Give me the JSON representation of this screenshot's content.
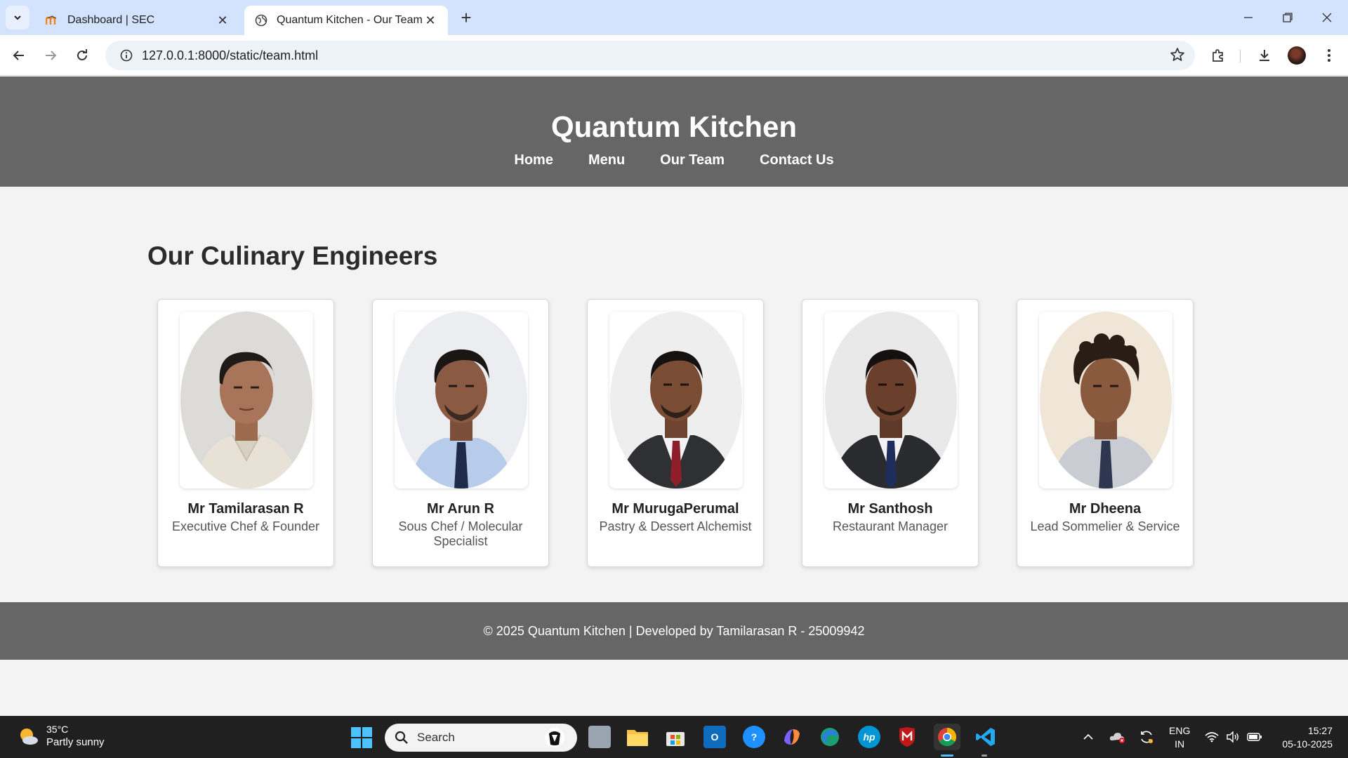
{
  "browser": {
    "tabs": [
      {
        "title": "Dashboard | SEC",
        "active": false
      },
      {
        "title": "Quantum Kitchen - Our Team",
        "active": true
      }
    ],
    "url": "127.0.0.1:8000/static/team.html"
  },
  "site": {
    "title": "Quantum Kitchen",
    "nav": [
      "Home",
      "Menu",
      "Our Team",
      "Contact Us"
    ]
  },
  "team_section": {
    "heading": "Our Culinary Engineers",
    "members": [
      {
        "name": "Mr Tamilarasan R",
        "role": "Executive Chef & Founder",
        "attire": "beige-shirt"
      },
      {
        "name": "Mr Arun R",
        "role": "Sous Chef / Molecular Specialist",
        "attire": "blue-shirt-tie"
      },
      {
        "name": "Mr MurugaPerumal",
        "role": "Pastry & Dessert Alchemist",
        "attire": "dark-suit-red-tie"
      },
      {
        "name": "Mr Santhosh",
        "role": "Restaurant Manager",
        "attire": "dark-suit-blue-tie"
      },
      {
        "name": "Mr Dheena",
        "role": "Lead Sommelier & Service",
        "attire": "grey-shirt-tie"
      }
    ]
  },
  "footer": {
    "text": "© 2025 Quantum Kitchen | Developed by Tamilarasan R - 25009942"
  },
  "taskbar": {
    "weather_temp": "35°C",
    "weather_desc": "Partly sunny",
    "search_label": "Search",
    "lang_top": "ENG",
    "lang_bottom": "IN",
    "time": "15:27",
    "date": "05-10-2025"
  },
  "colors": {
    "header_bg": "#666666",
    "page_bg": "#f3f3f3",
    "tabstrip_bg": "#d3e3fd",
    "taskbar_bg": "#202020"
  }
}
